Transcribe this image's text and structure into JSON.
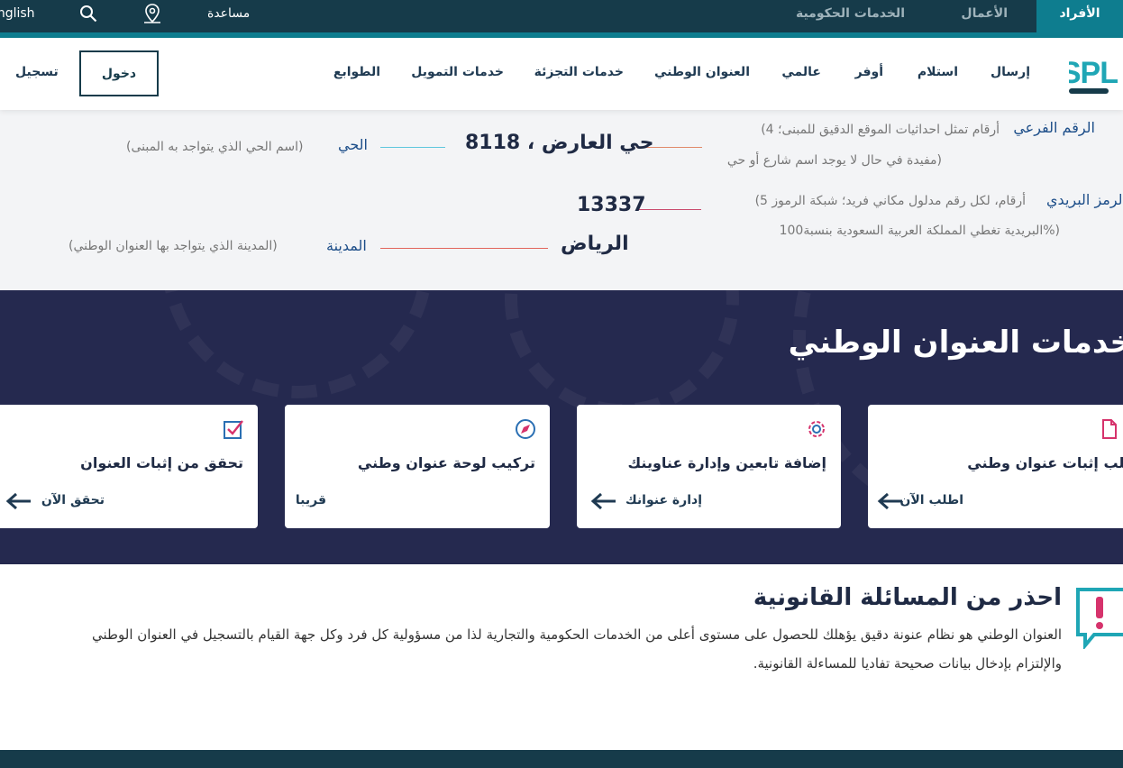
{
  "topbar": {
    "tabs": [
      "الأفراد",
      "الأعمال",
      "الخدمات الحكومية"
    ],
    "help": "مساعدة",
    "english": "English",
    "colors": {
      "bar": "#163b4a",
      "accent": "#0e7d8f"
    }
  },
  "header": {
    "logo": "SPL",
    "nav": [
      "إرسال",
      "استلام",
      "أوفر",
      "عالمي",
      "العنوان الوطني",
      "خدمات التجزئة",
      "خدمات التمويل",
      "الطوابع"
    ],
    "login": "دخول",
    "register": "تسجيل"
  },
  "address": {
    "sub_number": {
      "label": "الرقم الفرعي",
      "desc1": "(4 أرقام تمثل احداثيات الموقع الدقيق للمبنى؛",
      "desc2": "مفيدة في حال لا يوجد اسم شارع أو حي)"
    },
    "district": {
      "label": "الحي",
      "desc": "(اسم الحي الذي يتواجد به المبنى)",
      "value": "8118 ، حي العارض"
    },
    "postal": {
      "label": "الرمز البريدي",
      "desc1": "(5 أرقام، لكل رقم مدلول مكاني فريد؛ شبكة الرموز",
      "desc2": "البريدية تغطي المملكة العربية السعودية بنسبة100%)",
      "value": "13337"
    },
    "city": {
      "label": "المدينة",
      "desc": "(المدينة الذي يتواجد بها العنوان الوطني)",
      "value": "الرياض"
    }
  },
  "services": {
    "title": "خدمات العنوان الوطني",
    "cards": [
      {
        "title": "طلب إثبات عنوان وطني",
        "action": "اطلب الآن",
        "icon": "document-icon"
      },
      {
        "title": "إضافة تابعين وإدارة عناوينك",
        "action": "إدارة عنوانك",
        "icon": "gear-icon"
      },
      {
        "title": "تركيب لوحة عنوان وطني",
        "action": "قريبا",
        "icon": "compass-icon"
      },
      {
        "title": "تحقق من إثبات العنوان",
        "action": "تحقق الآن",
        "icon": "checkbox-icon"
      }
    ]
  },
  "warning": {
    "title": "احذر من المسائلة القانونية",
    "body": "العنوان الوطني هو نظام عنونة دقيق يؤهلك للحصول على مستوى أعلى من الخدمات الحكومية والتجارية لذا من مسؤولية كل فرد وكل جهة القيام بالتسجيل في العنوان الوطني والإلتزام بإدخال بيانات صحيحة تفاديا للمساءلة القانونية."
  }
}
